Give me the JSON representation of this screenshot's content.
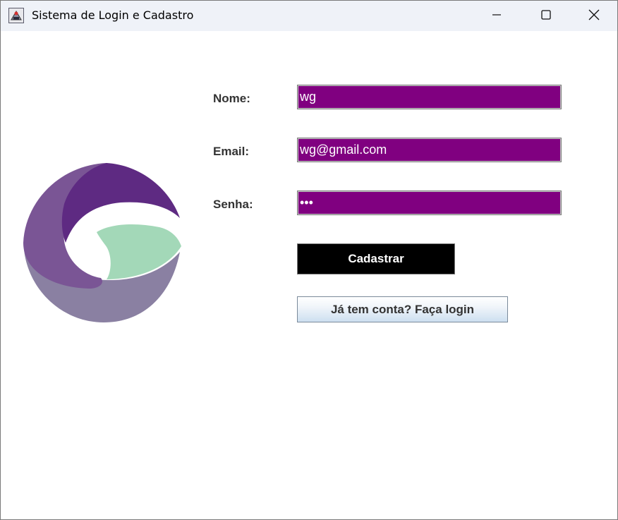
{
  "window": {
    "title": "Sistema de Login e Cadastro"
  },
  "icons": {
    "app": "java-app-icon",
    "minimize": "minimize-icon",
    "maximize": "maximize-icon",
    "close": "close-icon",
    "logo": "logo-image"
  },
  "form": {
    "nome_label": "Nome:",
    "nome_value": "wg",
    "email_label": "Email:",
    "email_value": "wg@gmail.com",
    "senha_label": "Senha:",
    "senha_value": "•••"
  },
  "buttons": {
    "cadastrar": "Cadastrar",
    "login": "Já tem conta? Faça login"
  },
  "colors": {
    "field_background": "#800080",
    "cadastrar_background": "#000000",
    "logo_purple_dark": "#5e2a82",
    "logo_purple_mid": "#7a5595",
    "logo_gray": "#8a80a2",
    "logo_green": "#a3d8b8"
  }
}
